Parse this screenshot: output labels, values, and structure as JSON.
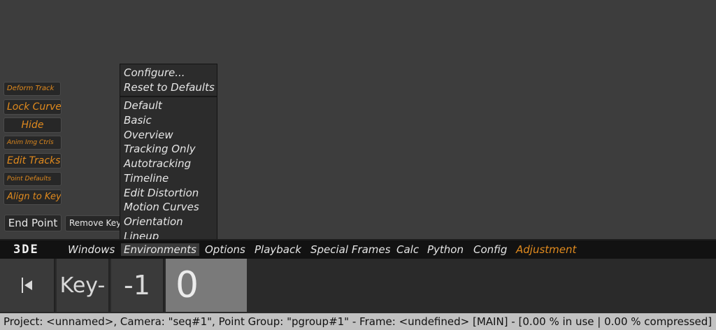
{
  "tool_buttons": [
    {
      "label": "Deform Track"
    },
    {
      "label": "Lock Curve"
    },
    {
      "label": "Hide"
    },
    {
      "label": "Anim Img Ctrls"
    },
    {
      "label": "Edit Tracks"
    },
    {
      "label": "Point Defaults"
    },
    {
      "label": "Align to Key"
    }
  ],
  "bottom_buttons": {
    "end_point": "End Point",
    "remove_key": "Remove Key"
  },
  "environments_menu": {
    "top_items": [
      "Configure...",
      "Reset to Defaults"
    ],
    "items": [
      "Default",
      "Basic",
      "Overview",
      "Tracking Only",
      "Autotracking",
      "Timeline",
      "Edit Distortion",
      "Motion Curves",
      "Orientation",
      "Lineup"
    ]
  },
  "menubar": {
    "logo": "3DE",
    "items": [
      "Windows",
      "Environments",
      "Options",
      "Playback",
      "Special Frames",
      "Calc",
      "Python",
      "Config",
      "Adjustment"
    ],
    "active": "Environments",
    "accent_color": "#e08a1e"
  },
  "timeline": {
    "first_icon": "skip-to-start-icon",
    "key_label": "Key-",
    "offset_label": "-1",
    "frame_label": "0"
  },
  "status_bar": {
    "text": "Project: <unnamed>, Camera: \"seq#1\", Point Group: \"pgroup#1\"  -  Frame: <undefined>  [MAIN]  -  [0.00 % in use | 0.00 % compressed]"
  }
}
